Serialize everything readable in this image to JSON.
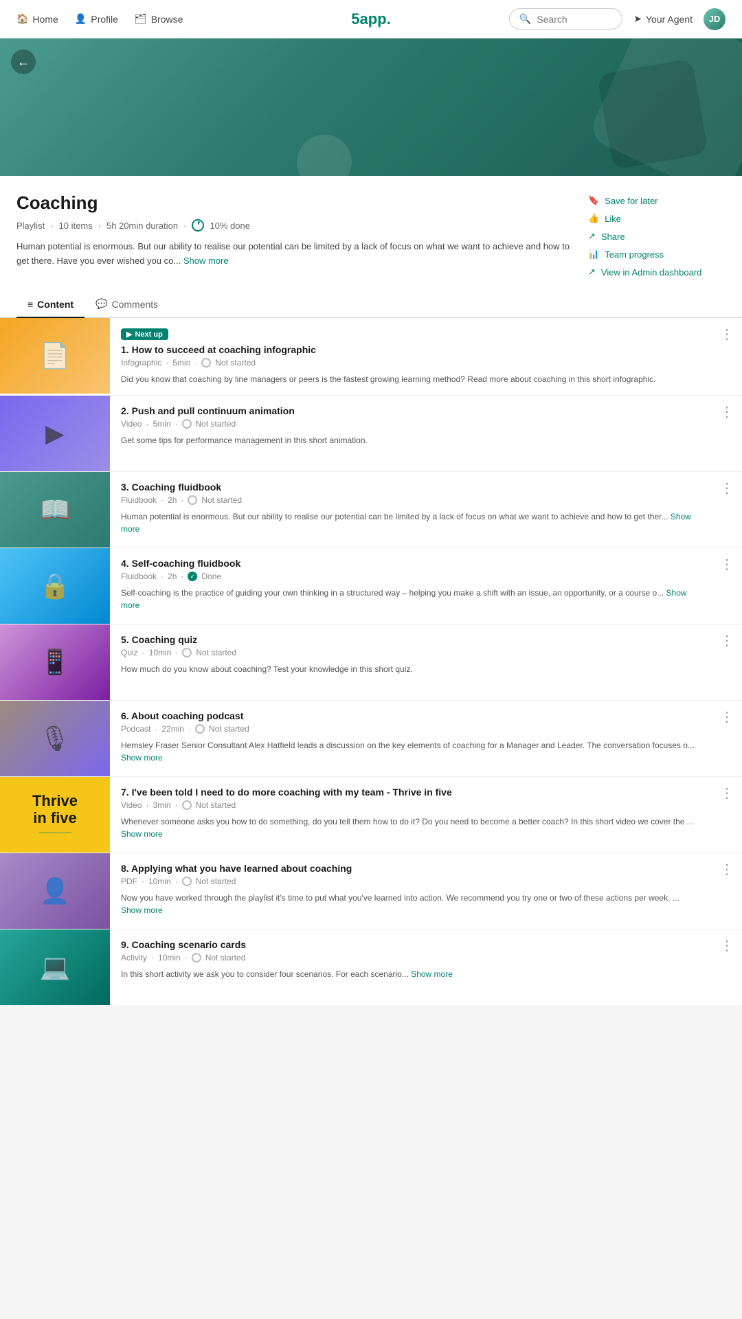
{
  "nav": {
    "home_label": "Home",
    "profile_label": "Profile",
    "browse_label": "Browse",
    "logo": "5app.",
    "search_placeholder": "Search",
    "agent_label": "Your Agent",
    "avatar_initials": "JD"
  },
  "playlist": {
    "title": "Coaching",
    "meta_type": "Playlist",
    "meta_items": "10 items",
    "meta_duration": "5h 20min duration",
    "meta_progress": "10% done",
    "description": "Human potential is enormous. But our ability to realise our potential can be limited by a lack of focus on what we want to achieve and how to get there. Have you ever wished you co...",
    "show_more": "Show more",
    "actions": {
      "save": "Save for later",
      "like": "Like",
      "share": "Share",
      "team_progress": "Team progress",
      "admin_dashboard": "View in Admin dashboard"
    }
  },
  "tabs": [
    {
      "label": "Content",
      "active": true
    },
    {
      "label": "Comments",
      "active": false
    }
  ],
  "items": [
    {
      "number": "1.",
      "title": "How to succeed at coaching infographic",
      "type": "Infographic",
      "duration": "5min",
      "status": "Not started",
      "status_done": false,
      "next_up": true,
      "description": "Did you know that coaching by line managers or peers is the fastest growing learning method? Read more about coaching in this short infographic.",
      "show_more": false,
      "thumb_class": "thumb-1",
      "thumb_icon": "📄"
    },
    {
      "number": "2.",
      "title": "Push and pull continuum animation",
      "type": "Video",
      "duration": "5min",
      "status": "Not started",
      "status_done": false,
      "next_up": false,
      "description": "Get some tips for performance management in this short animation.",
      "show_more": false,
      "thumb_class": "thumb-2",
      "thumb_icon": "▶"
    },
    {
      "number": "3.",
      "title": "Coaching fluidbook",
      "type": "Fluidbook",
      "duration": "2h",
      "status": "Not started",
      "status_done": false,
      "next_up": false,
      "description": "Human potential is enormous. But our ability to realise our potential can be limited by a lack of focus on what we want to achieve and how to get ther...",
      "show_more": true,
      "show_more_label": "Show more",
      "thumb_class": "thumb-3",
      "thumb_icon": "📖"
    },
    {
      "number": "4.",
      "title": "Self-coaching fluidbook",
      "type": "Fluidbook",
      "duration": "2h",
      "status": "Done",
      "status_done": true,
      "next_up": false,
      "description": "Self-coaching is the practice of guiding your own thinking in a structured way – helping you make a shift with an issue, an opportunity, or a course o...",
      "show_more": true,
      "show_more_label": "Show more",
      "thumb_class": "thumb-4",
      "thumb_icon": "🔒"
    },
    {
      "number": "5.",
      "title": "Coaching quiz",
      "type": "Quiz",
      "duration": "10min",
      "status": "Not started",
      "status_done": false,
      "next_up": false,
      "description": "How much do you know about coaching? Test your knowledge in this short quiz.",
      "show_more": false,
      "thumb_class": "thumb-5",
      "thumb_icon": "📱"
    },
    {
      "number": "6.",
      "title": "About coaching podcast",
      "type": "Podcast",
      "duration": "22min",
      "status": "Not started",
      "status_done": false,
      "next_up": false,
      "description": "Hemsley Fraser Senior Consultant Alex Hatfield leads a discussion on the key elements of coaching for a Manager and Leader. The conversation focuses o...",
      "show_more": true,
      "show_more_label": "Show more",
      "thumb_class": "thumb-6",
      "thumb_icon": "🎙"
    },
    {
      "number": "7.",
      "title": "I've been told I need to do more coaching with my team - Thrive in five",
      "type": "Video",
      "duration": "3min",
      "status": "Not started",
      "status_done": false,
      "next_up": false,
      "description": "Whenever someone asks you how to do something, do you tell them how to do it? Do you need to become a better coach? In this short video we cover the ...",
      "show_more": true,
      "show_more_label": "Show more",
      "thumb_class": "thumb-7",
      "thumb_text": "Thrive\nin five",
      "thumb_icon": null
    },
    {
      "number": "8.",
      "title": "Applying what you have learned about coaching",
      "type": "PDF",
      "duration": "10min",
      "status": "Not started",
      "status_done": false,
      "next_up": false,
      "description": "Now you have worked through the playlist it's time to put what you've learned into action. We recommend you try one or two of these actions per week. ...",
      "show_more": true,
      "show_more_label": "Show more",
      "thumb_class": "thumb-8",
      "thumb_icon": "👤"
    },
    {
      "number": "9.",
      "title": "Coaching scenario cards",
      "type": "Activity",
      "duration": "10min",
      "status": "Not started",
      "status_done": false,
      "next_up": false,
      "description": "In this short activity we ask you to consider four scenarios. For each scenario...",
      "show_more": true,
      "show_more_label": "Show more",
      "thumb_class": "thumb-9",
      "thumb_icon": "💻"
    }
  ]
}
